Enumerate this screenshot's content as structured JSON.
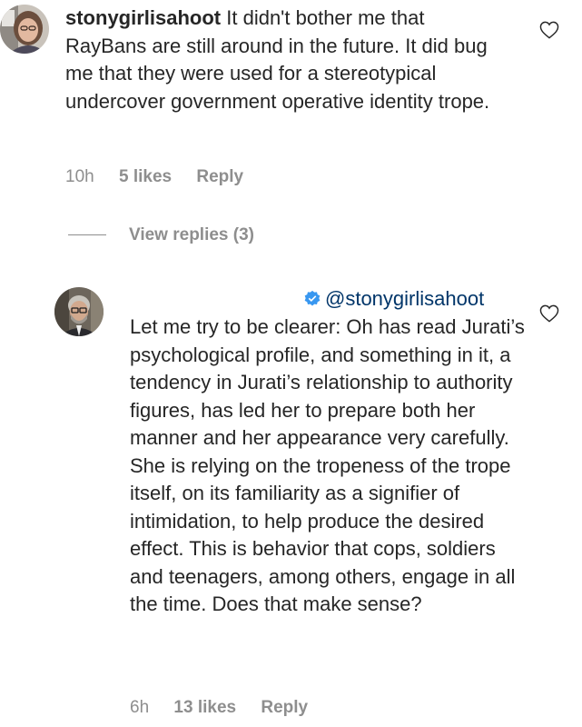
{
  "comments": [
    {
      "username": "stonygirlisahoot",
      "text": "It didn't bother me that RayBans are still around in the future. It did bug me that they were used for a stereotypical undercover government operative identity trope.",
      "time": "10h",
      "likes": "5 likes",
      "reply_label": "Reply",
      "avatar_icon": "user-avatar-woman"
    },
    {
      "mention": "@stonygirlisahoot",
      "text": "Let me try to be clearer: Oh has read Jurati’s psychological profile, and something in it, a tendency in Jurati’s relationship to authority figures, has led her to prepare both her manner and her appearance very carefully. She is relying on the tropeness of the trope itself, on its familiarity as a signifier of intimidation, to help produce the desired effect. This is behavior that cops, soldiers and teenagers, among others, engage in all the time. Does that make sense?",
      "time": "6h",
      "likes": "13 likes",
      "reply_label": "Reply",
      "avatar_icon": "user-avatar-man",
      "verified_icon": "verified-badge-icon"
    }
  ],
  "view_replies_label": "View replies (3)",
  "colors": {
    "text": "#262626",
    "meta": "#8e8e8e",
    "mention": "#003569",
    "verified": "#3897f0"
  }
}
